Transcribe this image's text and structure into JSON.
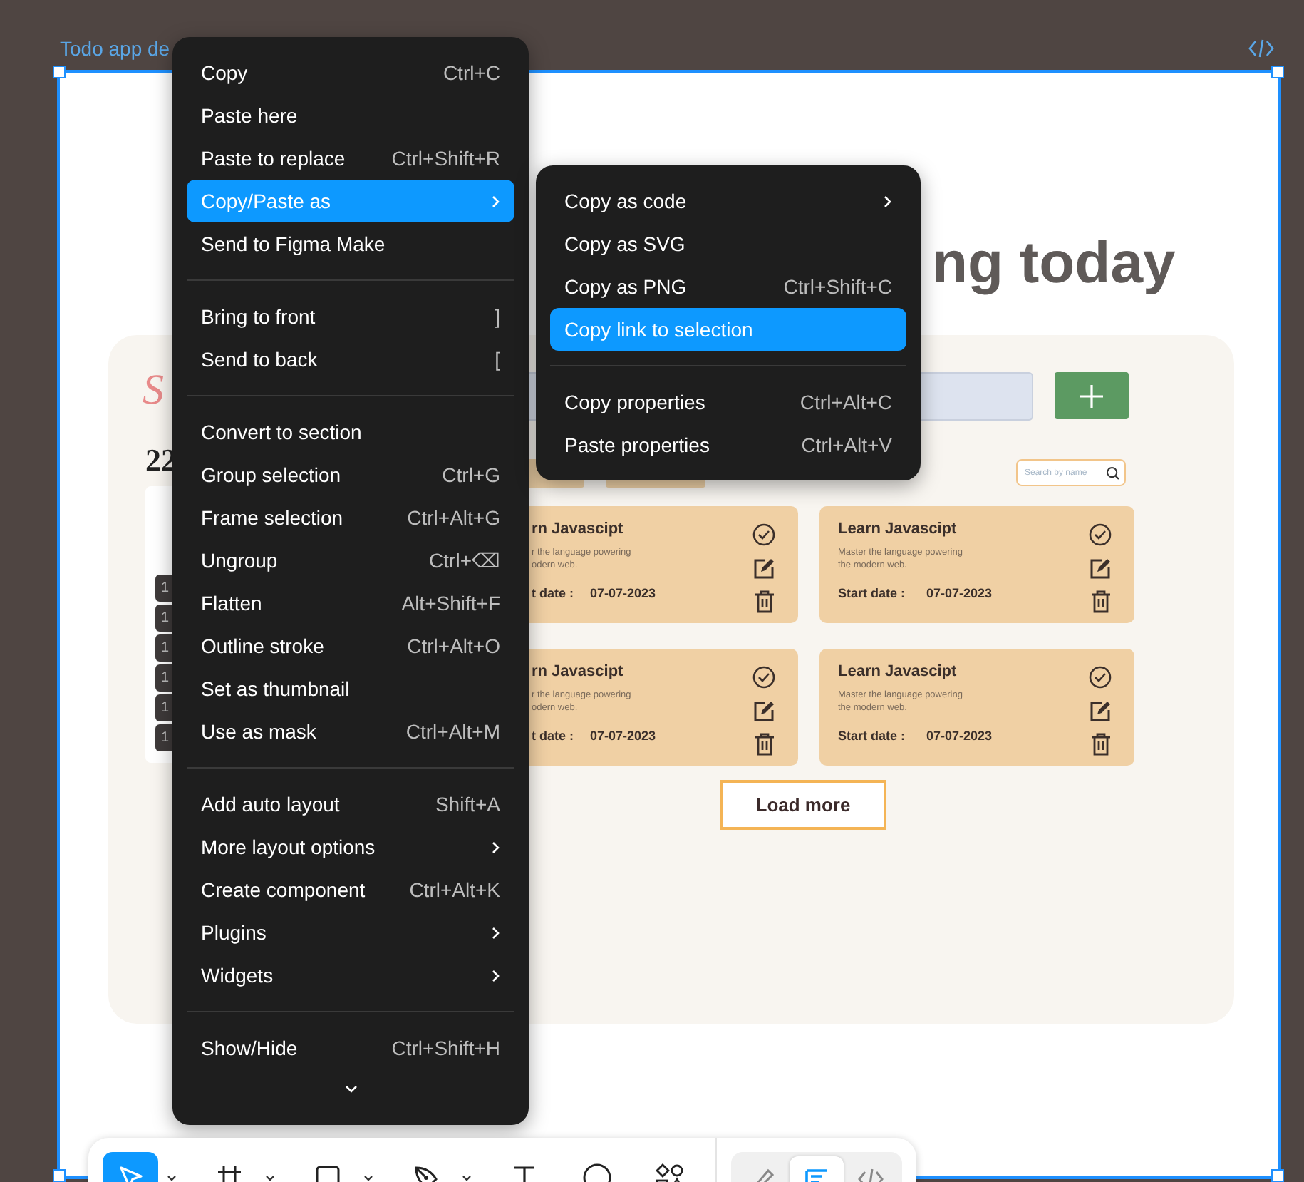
{
  "frame": {
    "label": "Todo app de"
  },
  "design": {
    "heading": "ng today",
    "logo": "S",
    "date": "22",
    "day_tags": [
      "1",
      "1",
      "1",
      "1",
      "1",
      "1"
    ],
    "search": {
      "placeholder": "Search by name"
    },
    "cards": [
      {
        "title": "rn Javascipt",
        "description": [
          "r the language powering",
          "odern web."
        ],
        "date_label": "t date :",
        "date": "07-07-2023"
      },
      {
        "title": "Learn Javascipt",
        "description": [
          "Master the language powering",
          "the modern web."
        ],
        "date_label": "Start date :",
        "date": "07-07-2023"
      },
      {
        "title": "rn Javascipt",
        "description": [
          "r the language powering",
          "odern web."
        ],
        "date_label": "t date :",
        "date": "07-07-2023"
      },
      {
        "title": "Learn Javascipt",
        "description": [
          "Master the language powering",
          "the modern web."
        ],
        "date_label": "Start date :",
        "date": "07-07-2023"
      }
    ],
    "load_more": "Load more"
  },
  "context_menu": {
    "sections": [
      [
        {
          "label": "Copy",
          "shortcut": "Ctrl+C",
          "submenu": false,
          "selected": false
        },
        {
          "label": "Paste here",
          "submenu": false,
          "selected": false
        },
        {
          "label": "Paste to replace",
          "shortcut": "Ctrl+Shift+R",
          "submenu": false,
          "selected": false
        },
        {
          "label": "Copy/Paste as",
          "submenu": true,
          "selected": true
        },
        {
          "label": "Send to Figma Make",
          "submenu": false,
          "selected": false
        }
      ],
      [
        {
          "label": "Bring to front",
          "shortcut": "]",
          "submenu": false,
          "selected": false
        },
        {
          "label": "Send to back",
          "shortcut": "[",
          "submenu": false,
          "selected": false
        }
      ],
      [
        {
          "label": "Convert to section",
          "submenu": false,
          "selected": false
        },
        {
          "label": "Group selection",
          "shortcut": "Ctrl+G",
          "submenu": false,
          "selected": false
        },
        {
          "label": "Frame selection",
          "shortcut": "Ctrl+Alt+G",
          "submenu": false,
          "selected": false
        },
        {
          "label": "Ungroup",
          "shortcut": "Ctrl+⌫",
          "submenu": false,
          "selected": false
        },
        {
          "label": "Flatten",
          "shortcut": "Alt+Shift+F",
          "submenu": false,
          "selected": false
        },
        {
          "label": "Outline stroke",
          "shortcut": "Ctrl+Alt+O",
          "submenu": false,
          "selected": false
        },
        {
          "label": "Set as thumbnail",
          "submenu": false,
          "selected": false
        },
        {
          "label": "Use as mask",
          "shortcut": "Ctrl+Alt+M",
          "submenu": false,
          "selected": false
        }
      ],
      [
        {
          "label": "Add auto layout",
          "shortcut": "Shift+A",
          "submenu": false,
          "selected": false
        },
        {
          "label": "More layout options",
          "submenu": true,
          "selected": false
        },
        {
          "label": "Create component",
          "shortcut": "Ctrl+Alt+K",
          "submenu": false,
          "selected": false
        },
        {
          "label": "Plugins",
          "submenu": true,
          "selected": false
        },
        {
          "label": "Widgets",
          "submenu": true,
          "selected": false
        }
      ],
      [
        {
          "label": "Show/Hide",
          "shortcut": "Ctrl+Shift+H",
          "submenu": false,
          "selected": false
        }
      ]
    ]
  },
  "submenu": {
    "sections": [
      [
        {
          "label": "Copy as code",
          "submenu": true,
          "selected": false
        },
        {
          "label": "Copy as SVG",
          "submenu": false,
          "selected": false
        },
        {
          "label": "Copy as PNG",
          "shortcut": "Ctrl+Shift+C",
          "submenu": false,
          "selected": false
        },
        {
          "label": "Copy link to selection",
          "submenu": false,
          "selected": true
        }
      ],
      [
        {
          "label": "Copy properties",
          "shortcut": "Ctrl+Alt+C",
          "submenu": false,
          "selected": false
        },
        {
          "label": "Paste properties",
          "shortcut": "Ctrl+Alt+V",
          "submenu": false,
          "selected": false
        }
      ]
    ]
  },
  "toolbar": {
    "tools": [
      {
        "kind": "move",
        "selected": true,
        "dropdown": true
      },
      {
        "kind": "frame",
        "selected": false,
        "dropdown": true
      },
      {
        "kind": "rectangle",
        "selected": false,
        "dropdown": true
      },
      {
        "kind": "pen",
        "selected": false,
        "dropdown": true
      },
      {
        "kind": "text",
        "selected": false,
        "dropdown": false
      },
      {
        "kind": "ellipse",
        "selected": false,
        "dropdown": false
      },
      {
        "kind": "shapes",
        "selected": false,
        "dropdown": false
      }
    ],
    "modes": [
      {
        "kind": "draw",
        "selected": false
      },
      {
        "kind": "design",
        "selected": true
      },
      {
        "kind": "dev",
        "selected": false
      }
    ]
  }
}
